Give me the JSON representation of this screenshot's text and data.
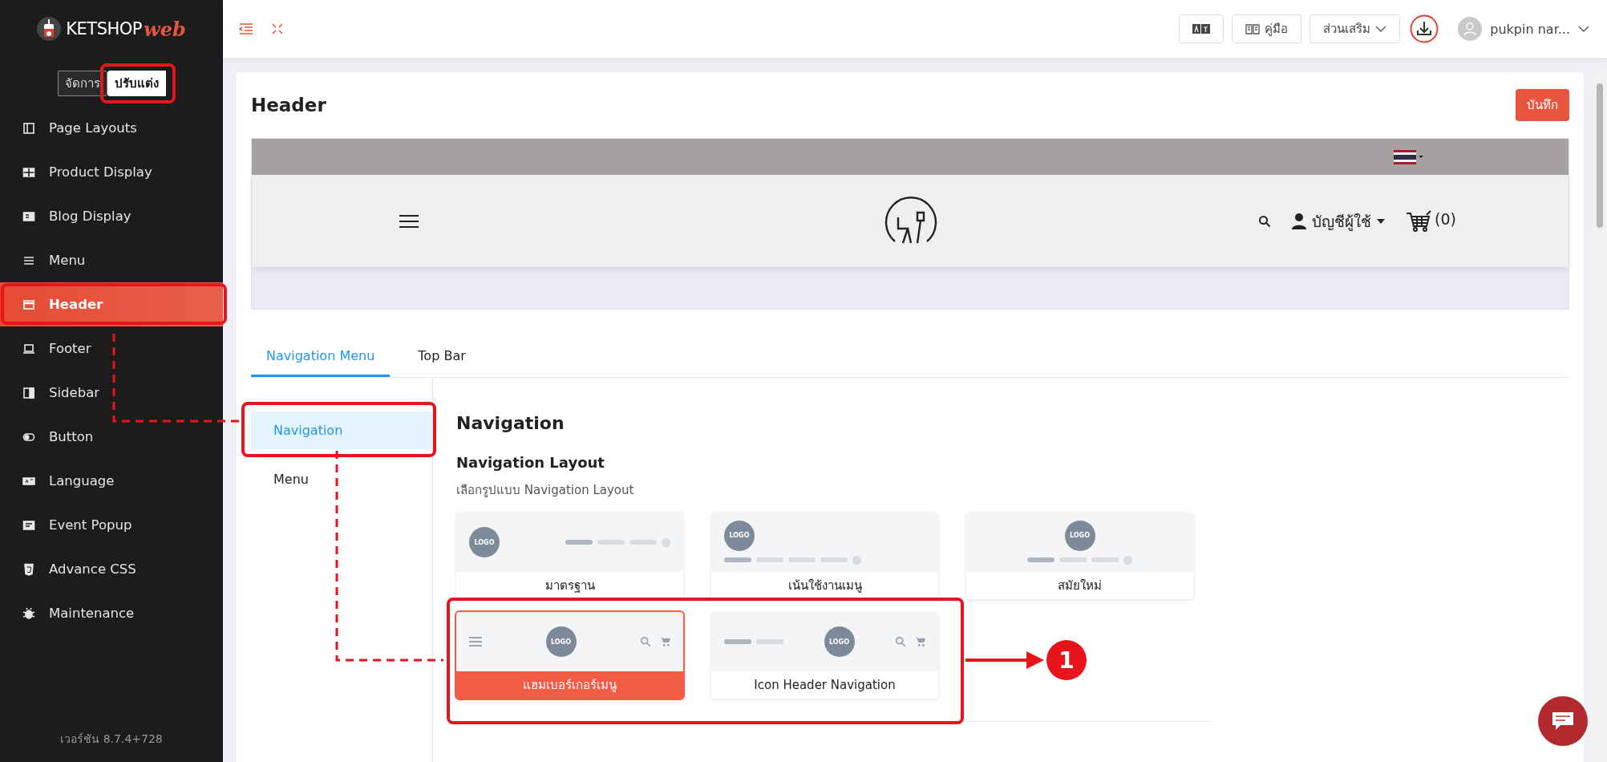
{
  "brand": {
    "name": "KETSHOP",
    "accent": "web"
  },
  "mode_toggle": [
    {
      "label": "จัดการ",
      "selected": false
    },
    {
      "label": "ปรับแต่ง",
      "selected": true
    }
  ],
  "sidebar": {
    "items": [
      {
        "label": "Page Layouts",
        "selected": false
      },
      {
        "label": "Product Display",
        "selected": false
      },
      {
        "label": "Blog Display",
        "selected": false
      },
      {
        "label": "Menu",
        "selected": false
      },
      {
        "label": "Header",
        "selected": true
      },
      {
        "label": "Footer",
        "selected": false
      },
      {
        "label": "Sidebar",
        "selected": false
      },
      {
        "label": "Button",
        "selected": false
      },
      {
        "label": "Language",
        "selected": false
      },
      {
        "label": "Event Popup",
        "selected": false
      },
      {
        "label": "Advance CSS",
        "selected": false
      },
      {
        "label": "Maintenance",
        "selected": false
      }
    ],
    "version": "เวอร์ชัน 8.7.4+728"
  },
  "topbar": {
    "manual": "คู่มือ",
    "addons": "ส่วนเสริม",
    "user": "pukpin nar..."
  },
  "page": {
    "title": "Header",
    "save": "บันทึก"
  },
  "preview": {
    "account": "บัญชีผู้ใช้",
    "cart": "(0)"
  },
  "tabs": [
    {
      "label": "Navigation Menu",
      "selected": true
    },
    {
      "label": "Top Bar",
      "selected": false
    }
  ],
  "submenu": [
    {
      "label": "Navigation",
      "selected": true
    },
    {
      "label": "Menu",
      "selected": false
    }
  ],
  "section": {
    "title": "Navigation",
    "subtitle": "Navigation Layout",
    "hint": "เลือกรูปแบบ Navigation Layout"
  },
  "layouts": [
    {
      "label": "มาตรฐาน",
      "kind": "standard",
      "logo": "LOGO",
      "selected": false
    },
    {
      "label": "เน้นใช้งานเมนู",
      "kind": "menu-focus",
      "logo": "LOGO",
      "selected": false
    },
    {
      "label": "สมัยใหม่",
      "kind": "modern",
      "logo": "LOGO",
      "selected": false
    },
    {
      "label": "แฮมเบอร์เกอร์เมนู",
      "kind": "hamburger",
      "logo": "LOGO",
      "selected": true
    },
    {
      "label": "Icon Header Navigation",
      "kind": "icon-header",
      "logo": "LOGO",
      "selected": false
    }
  ],
  "annotation": {
    "number": "1"
  }
}
